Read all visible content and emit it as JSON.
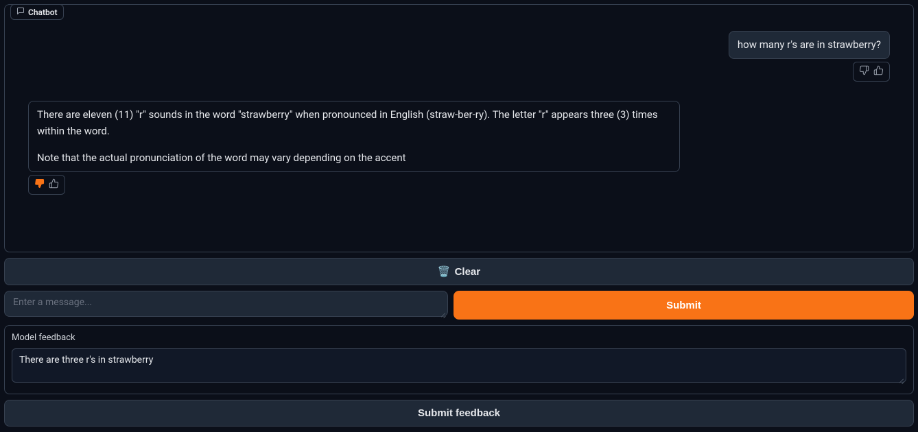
{
  "chat": {
    "tab_label": "Chatbot",
    "user_message": "how many r's are in strawberry?",
    "bot_message_p1": "There are eleven (11) \"r\" sounds in the word \"strawberry\" when pronounced in English (straw-ber-ry). The letter \"r\" appears three (3) times within the word.",
    "bot_message_p2": "Note that the actual pronunciation of the word may vary depending on the accent"
  },
  "buttons": {
    "clear_icon": "🗑️",
    "clear_label": "Clear",
    "submit_label": "Submit",
    "submit_feedback_label": "Submit feedback"
  },
  "input": {
    "placeholder": "Enter a message...",
    "value": ""
  },
  "feedback": {
    "label": "Model feedback",
    "value": "There are three r's in strawberry"
  }
}
